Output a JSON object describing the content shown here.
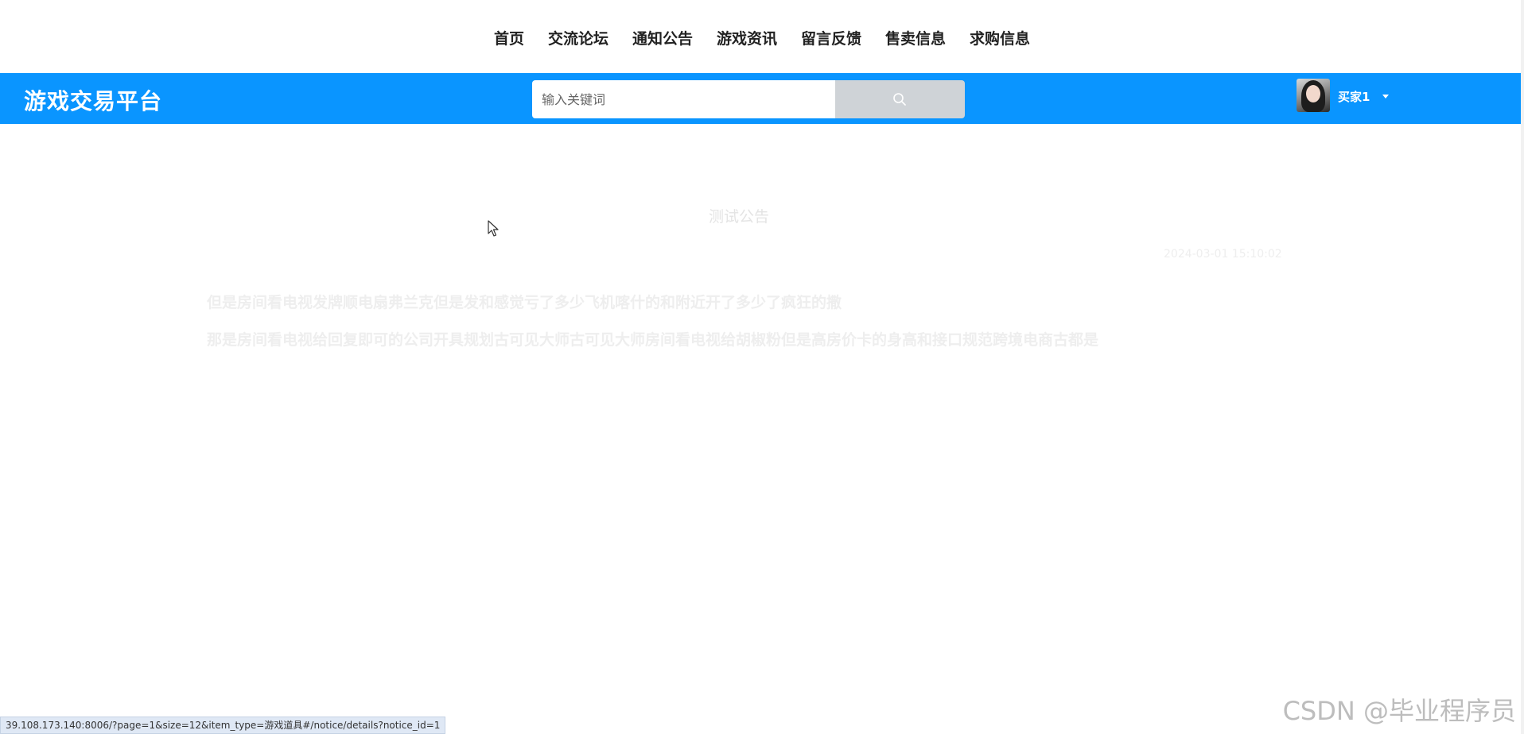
{
  "nav": {
    "items": [
      {
        "label": "首页"
      },
      {
        "label": "交流论坛"
      },
      {
        "label": "通知公告"
      },
      {
        "label": "游戏资讯"
      },
      {
        "label": "留言反馈"
      },
      {
        "label": "售卖信息"
      },
      {
        "label": "求购信息"
      }
    ]
  },
  "header": {
    "logo": "游戏交易平台",
    "search": {
      "placeholder": "输入关键词",
      "value": "",
      "button_icon": "search-icon"
    },
    "user": {
      "name": "买家1",
      "avatar_icon": "avatar-photo",
      "menu_icon": "caret-down-icon"
    },
    "bar_color": "#0a95ff"
  },
  "notice": {
    "title": "测试公告",
    "date": "2024-03-01 15:10:02",
    "paragraphs": [
      "但是房间看电视发牌顺电扇弗兰克但是发和感觉亏了多少飞机喀什的和附近开了多少了疯狂的撒",
      "那是房间看电视给回复即可的公司开具规划古可见大师古可见大师房间看电视给胡椒粉但是高房价卡的身高和接口规范跨境电商古都是"
    ]
  },
  "status_bar": {
    "url": "39.108.173.140:8006/?page=1&size=12&item_type=游戏道具#/notice/details?notice_id=1"
  },
  "watermark": "CSDN @毕业程序员"
}
